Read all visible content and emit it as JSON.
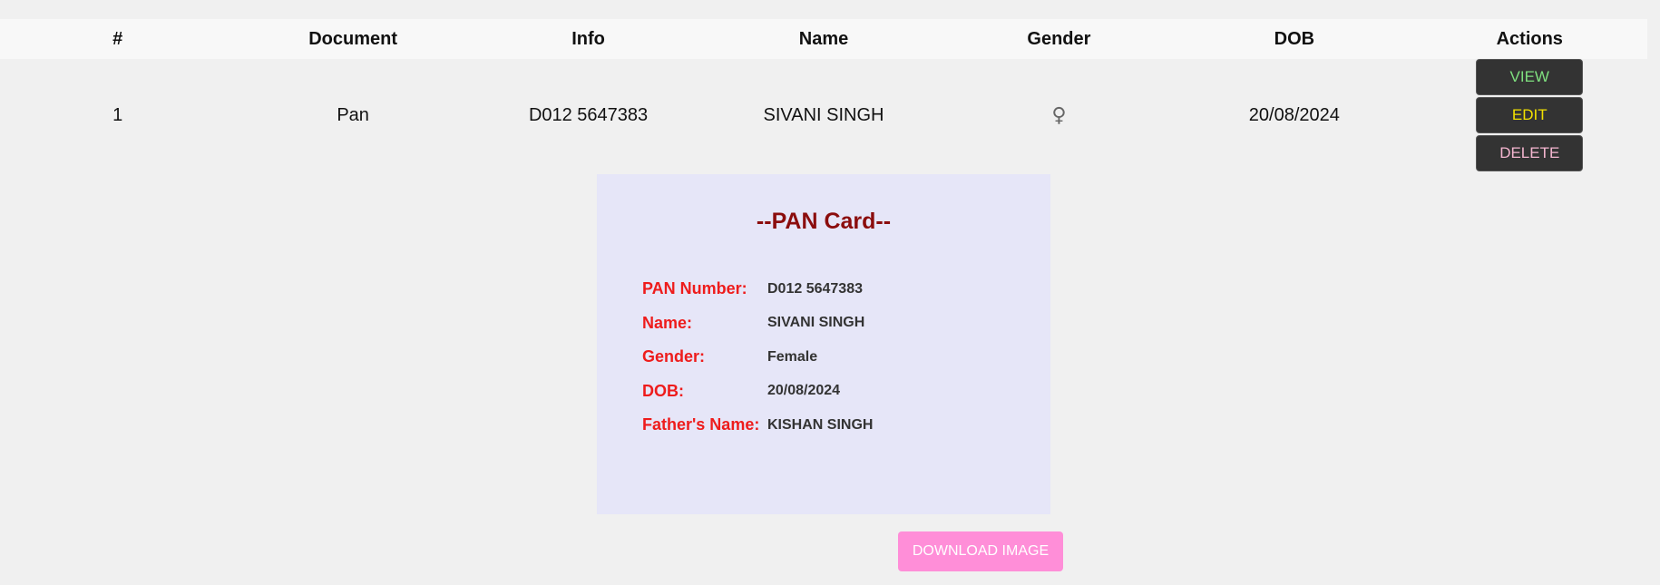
{
  "table": {
    "headers": [
      "#",
      "Document",
      "Info",
      "Name",
      "Gender",
      "DOB",
      "Actions"
    ],
    "rows": [
      {
        "index": "1",
        "document": "Pan",
        "info": "D012 5647383",
        "name": "SIVANI SINGH",
        "gender_icon": "♀",
        "dob": "20/08/2024",
        "actions": {
          "view": "VIEW",
          "edit": "EDIT",
          "delete": "DELETE"
        }
      }
    ]
  },
  "card": {
    "title": "--PAN Card--",
    "fields": [
      {
        "label": "PAN Number:",
        "value": "D012 5647383"
      },
      {
        "label": "Name:",
        "value": "SIVANI SINGH"
      },
      {
        "label": "Gender:",
        "value": "Female"
      },
      {
        "label": "DOB:",
        "value": "20/08/2024"
      },
      {
        "label": "Father's Name:",
        "value": "KISHAN SINGH"
      }
    ]
  },
  "download_label": "DOWNLOAD IMAGE",
  "colors": {
    "page_background": "#f0f0f0",
    "card_background": "#e6e6f8",
    "card_title": "#8b0d0d",
    "card_label": "#ee1c1c",
    "download_button": "#ff8ed8",
    "view_text": "#7fe07f",
    "edit_text": "#f2e000",
    "delete_text": "#f4b6d0"
  },
  "icons": {
    "gender": "female-symbol-icon"
  }
}
